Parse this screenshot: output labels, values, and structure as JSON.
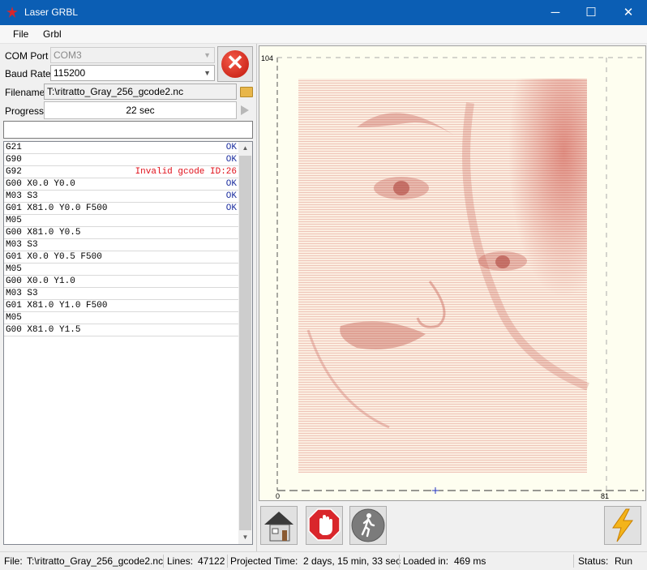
{
  "window": {
    "title": "Laser GRBL",
    "minimize_glyph": "─",
    "maximize_glyph": "☐",
    "close_glyph": "✕"
  },
  "menu": {
    "file": "File",
    "grbl": "Grbl"
  },
  "connection": {
    "com_port_label": "COM Port",
    "com_port_value": "COM3",
    "baud_rate_label": "Baud Rate",
    "baud_rate_value": "115200"
  },
  "file": {
    "filename_label": "Filename",
    "filename_value": "T:\\ritratto_Gray_256_gcode2.nc",
    "progress_label": "Progress",
    "progress_text": "22 sec",
    "progress_fraction": 0.0
  },
  "command_input": {
    "value": ""
  },
  "gcode_rows": [
    {
      "code": "G21",
      "status": "OK",
      "kind": "ok"
    },
    {
      "code": "G90",
      "status": "OK",
      "kind": "ok"
    },
    {
      "code": "G92",
      "status": "Invalid gcode ID:26",
      "kind": "err"
    },
    {
      "code": "G00 X0.0 Y0.0",
      "status": "OK",
      "kind": "ok"
    },
    {
      "code": "M03 S3",
      "status": "OK",
      "kind": "ok"
    },
    {
      "code": "G01 X81.0 Y0.0 F500",
      "status": "OK",
      "kind": "ok"
    },
    {
      "code": "M05",
      "status": "",
      "kind": ""
    },
    {
      "code": "G00 X81.0 Y0.5",
      "status": "",
      "kind": ""
    },
    {
      "code": "M03 S3",
      "status": "",
      "kind": ""
    },
    {
      "code": "G01 X0.0 Y0.5 F500",
      "status": "",
      "kind": ""
    },
    {
      "code": "M05",
      "status": "",
      "kind": ""
    },
    {
      "code": "G00 X0.0 Y1.0",
      "status": "",
      "kind": ""
    },
    {
      "code": "M03 S3",
      "status": "",
      "kind": ""
    },
    {
      "code": "G01 X81.0 Y1.0 F500",
      "status": "",
      "kind": ""
    },
    {
      "code": "M05",
      "status": "",
      "kind": ""
    },
    {
      "code": "G00 X81.0 Y1.5",
      "status": "",
      "kind": ""
    }
  ],
  "preview": {
    "y_max_label": "104",
    "origin_label": "0",
    "x_max_label": "81",
    "stroke_color": "#d9776a"
  },
  "toolbar": {
    "home_icon": "home-icon",
    "stop_icon": "stop-hand-icon",
    "walk_icon": "walking-man-icon",
    "flash_icon": "lightning-icon"
  },
  "statusbar": {
    "file_label": "File:",
    "file_value": "T:\\ritratto_Gray_256_gcode2.nc",
    "lines_label": "Lines:",
    "lines_value": "47122",
    "projected_label": "Projected Time:",
    "projected_value": "2 days, 15 min, 33 sec",
    "loaded_label": "Loaded in:",
    "loaded_value": "469 ms",
    "status_label": "Status:",
    "status_value": "Run"
  },
  "colors": {
    "titlebar": "#0b5eb4",
    "ok": "#1d2fa0",
    "error": "#e0101a",
    "canvas_bg": "#fefef0"
  }
}
